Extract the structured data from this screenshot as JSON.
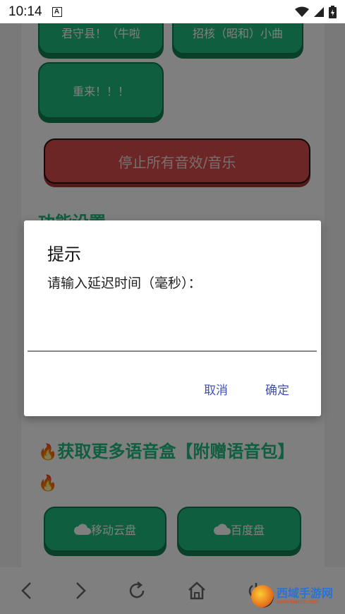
{
  "status": {
    "time": "10:14",
    "notif_glyph": "A"
  },
  "page": {
    "buttons_top": [
      "君守县！（牛啦",
      "招核（昭和）小曲"
    ],
    "restart_label": "重来！！！",
    "stop_label": "停止所有音效/音乐",
    "settings_title": "功能设置",
    "more_title": "获取更多语音盒【附赠语音包】",
    "cloud_buttons": [
      "移动云盘",
      "百度盘"
    ]
  },
  "dialog": {
    "title": "提示",
    "message": "请输入延迟时间（毫秒）：",
    "input_value": "",
    "cancel_label": "取消",
    "ok_label": "确定"
  },
  "watermark": {
    "name": "西域手游网",
    "url": "www.hanxm.com"
  },
  "colors": {
    "green": "#1fbd7e",
    "red": "#d94c4c",
    "accent": "#3f51b5"
  },
  "icons": [
    "wifi-icon",
    "signal-icon",
    "battery-icon",
    "back-icon",
    "forward-icon",
    "refresh-icon",
    "home-icon",
    "power-icon",
    "cloud-icon",
    "flame-icon"
  ]
}
